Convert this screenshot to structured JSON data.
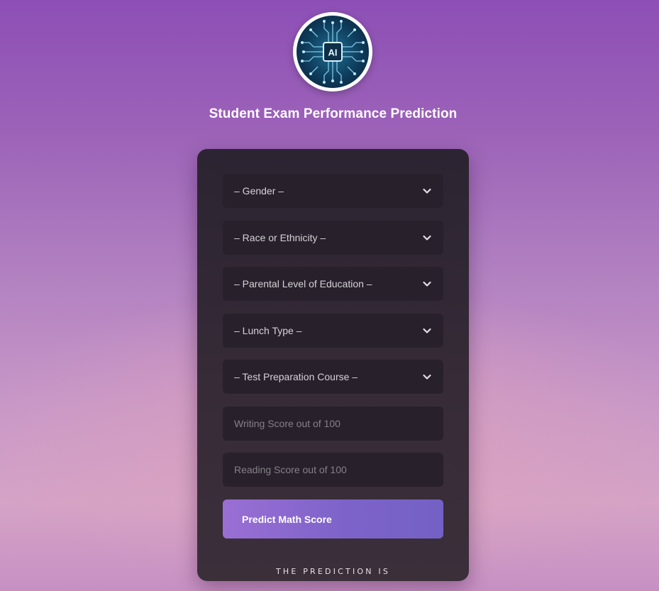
{
  "header": {
    "logo_text": "AI",
    "title": "Student Exam Performance Prediction"
  },
  "form": {
    "gender": "– Gender –",
    "race_ethnicity": "– Race or Ethnicity –",
    "parental_education": "– Parental Level of Education –",
    "lunch_type": "– Lunch Type –",
    "test_preparation": "– Test Preparation Course –",
    "writing_score_placeholder": "Writing Score out of 100",
    "reading_score_placeholder": "Reading Score out of 100",
    "submit_label": "Predict Math Score"
  },
  "result": {
    "label": "THE PREDICTION IS"
  },
  "colors": {
    "background_top": "#8d4fb6",
    "background_bottom": "#d5a3c6",
    "card": "#2c2432",
    "field": "#28212b",
    "button_start": "#9a6fd4",
    "button_end": "#7461c5"
  },
  "icons": {
    "logo": "ai-chip-icon",
    "dropdown": "chevron-down-icon"
  }
}
